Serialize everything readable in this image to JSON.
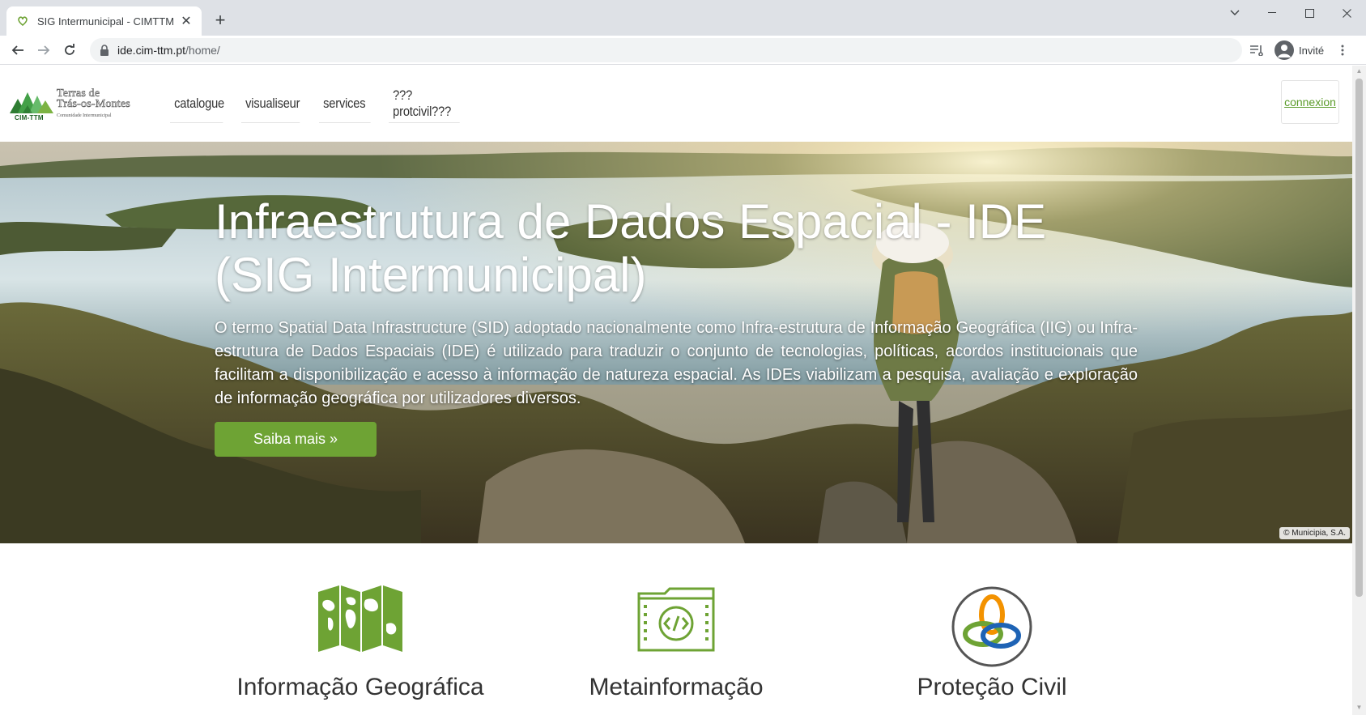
{
  "browser": {
    "tab_title": "SIG Intermunicipal - CIMTTM",
    "url_host": "ide.cim-ttm.pt",
    "url_path": "/home/",
    "profile_label": "Invité"
  },
  "header": {
    "logo": {
      "line1": "Terras de",
      "line2": "Trás-os-Montes",
      "line3": "Comunidade Intermunicipal",
      "abbr": "CIM-TTM"
    },
    "nav": [
      {
        "label": "catalogue"
      },
      {
        "label": "visualiseur"
      },
      {
        "label": "services"
      },
      {
        "label": "???protcivil???"
      }
    ],
    "login_label": "connexion"
  },
  "hero": {
    "title_line1": "Infraestrutura de Dados Espacial - IDE",
    "title_line2": "(SIG Intermunicipal)",
    "text": "O termo Spatial Data Infrastructure (SID) adoptado nacionalmente como Infra-estrutura de Informação Geográfica (IIG) ou Infra-estrutura de Dados Espaciais (IDE) é utilizado para traduzir o conjunto de tecnologias, políticas, acordos institucionais que facilitam a disponibilização e acesso à informação de natureza espacial. As IDEs viabilizam a pesquisa, avaliação e exploração de informação geográfica por utilizadores diversos.",
    "button_label": "Saiba mais »",
    "copyright": "© Municipia, S.A."
  },
  "features": [
    {
      "title": "Informação Geográfica",
      "icon": "world-map-icon"
    },
    {
      "title": "Metainformação",
      "icon": "code-folder-icon"
    },
    {
      "title": "Proteção Civil",
      "icon": "interlocking-rings-icon"
    }
  ],
  "colors": {
    "accent_green": "#6ea334",
    "link_green": "#5b9b2a"
  }
}
